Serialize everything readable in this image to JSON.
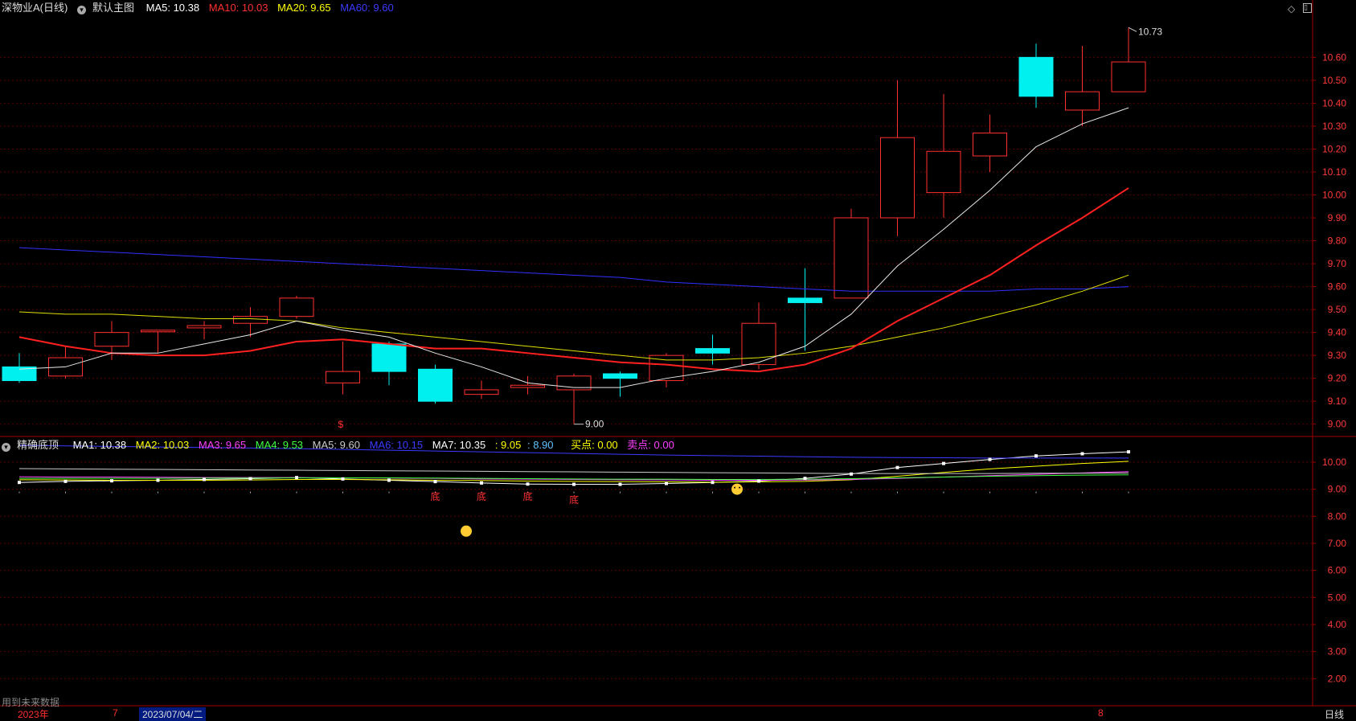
{
  "main_header": {
    "title": "深物业A(日线)",
    "dropdown_label": "默认主图",
    "ma": [
      {
        "label": "MA5: 10.38",
        "color": "#ffffff"
      },
      {
        "label": "MA10: 10.03",
        "color": "#ff3030"
      },
      {
        "label": "MA20: 9.65",
        "color": "#ffff00"
      },
      {
        "label": "MA60: 9.60",
        "color": "#3a3aff"
      }
    ]
  },
  "sub_header": {
    "title": "精确底顶",
    "items": [
      {
        "label": "MA1: 10.38",
        "color": "#ffffff"
      },
      {
        "label": "MA2: 10.03",
        "color": "#ffff00"
      },
      {
        "label": "MA3: 9.65",
        "color": "#ff40ff"
      },
      {
        "label": "MA4: 9.53",
        "color": "#40ff40"
      },
      {
        "label": "MA5: 9.60",
        "color": "#cccccc"
      },
      {
        "label": "MA6: 10.15",
        "color": "#3a3aff"
      },
      {
        "label": "MA7: 10.35",
        "color": "#ffffff"
      },
      {
        "label": ": 9.05",
        "color": "#ffff00"
      },
      {
        "label": ": 8.90",
        "color": "#60c0ff"
      },
      {
        "label": "买点: 0.00",
        "color": "#ffff00"
      },
      {
        "label": "卖点: 0.00",
        "color": "#ff40ff"
      }
    ]
  },
  "colors": {
    "up": "#ff3030",
    "down": "#00f0f0",
    "grid": "#5a0000"
  },
  "chart_data": [
    {
      "type": "candlestick",
      "ylim": [
        8.95,
        10.78
      ],
      "ticks": [
        "10.60",
        "10.50",
        "10.40",
        "10.30",
        "10.20",
        "10.10",
        "10.00",
        "9.90",
        "9.80",
        "9.70",
        "9.60",
        "9.50",
        "9.40",
        "9.30",
        "9.20",
        "9.10",
        "9.00"
      ],
      "candles": [
        {
          "o": 9.25,
          "h": 9.31,
          "l": 9.18,
          "c": 9.19
        },
        {
          "o": 9.21,
          "h": 9.34,
          "l": 9.2,
          "c": 9.29
        },
        {
          "o": 9.34,
          "h": 9.45,
          "l": 9.28,
          "c": 9.4
        },
        {
          "o": 9.41,
          "h": 9.41,
          "l": 9.31,
          "c": 9.41
        },
        {
          "o": 9.42,
          "h": 9.45,
          "l": 9.37,
          "c": 9.43
        },
        {
          "o": 9.44,
          "h": 9.51,
          "l": 9.38,
          "c": 9.47
        },
        {
          "o": 9.47,
          "h": 9.56,
          "l": 9.46,
          "c": 9.55
        },
        {
          "o": 9.18,
          "h": 9.36,
          "l": 9.13,
          "c": 9.23
        },
        {
          "o": 9.35,
          "h": 9.36,
          "l": 9.17,
          "c": 9.23
        },
        {
          "o": 9.24,
          "h": 9.26,
          "l": 9.09,
          "c": 9.1
        },
        {
          "o": 9.13,
          "h": 9.19,
          "l": 9.11,
          "c": 9.15
        },
        {
          "o": 9.16,
          "h": 9.21,
          "l": 9.13,
          "c": 9.17
        },
        {
          "o": 9.15,
          "h": 9.22,
          "l": 9.0,
          "c": 9.21
        },
        {
          "o": 9.22,
          "h": 9.23,
          "l": 9.12,
          "c": 9.2
        },
        {
          "o": 9.19,
          "h": 9.31,
          "l": 9.16,
          "c": 9.3
        },
        {
          "o": 9.33,
          "h": 9.39,
          "l": 9.26,
          "c": 9.31
        },
        {
          "o": 9.26,
          "h": 9.53,
          "l": 9.24,
          "c": 9.44
        },
        {
          "o": 9.55,
          "h": 9.68,
          "l": 9.32,
          "c": 9.53
        },
        {
          "o": 9.55,
          "h": 9.94,
          "l": 9.55,
          "c": 9.9
        },
        {
          "o": 9.9,
          "h": 10.5,
          "l": 9.82,
          "c": 10.25
        },
        {
          "o": 10.01,
          "h": 10.44,
          "l": 9.9,
          "c": 10.19
        },
        {
          "o": 10.17,
          "h": 10.35,
          "l": 10.1,
          "c": 10.27
        },
        {
          "o": 10.6,
          "h": 10.66,
          "l": 10.38,
          "c": 10.43
        },
        {
          "o": 10.37,
          "h": 10.65,
          "l": 10.3,
          "c": 10.45
        },
        {
          "o": 10.45,
          "h": 10.73,
          "l": 10.45,
          "c": 10.58
        }
      ],
      "ma5": [
        9.24,
        9.25,
        9.31,
        9.31,
        9.35,
        9.39,
        9.45,
        9.41,
        9.38,
        9.31,
        9.25,
        9.18,
        9.16,
        9.16,
        9.2,
        9.23,
        9.27,
        9.34,
        9.48,
        9.69,
        9.85,
        10.02,
        10.21,
        10.31,
        10.38
      ],
      "ma10": [
        9.38,
        9.34,
        9.31,
        9.3,
        9.3,
        9.32,
        9.36,
        9.37,
        9.35,
        9.33,
        9.33,
        9.31,
        9.29,
        9.27,
        9.26,
        9.24,
        9.23,
        9.26,
        9.33,
        9.45,
        9.55,
        9.65,
        9.78,
        9.9,
        10.03
      ],
      "ma20": [
        9.49,
        9.48,
        9.48,
        9.47,
        9.46,
        9.46,
        9.45,
        9.42,
        9.4,
        9.38,
        9.36,
        9.34,
        9.32,
        9.3,
        9.28,
        9.28,
        9.29,
        9.31,
        9.34,
        9.38,
        9.42,
        9.47,
        9.52,
        9.58,
        9.65
      ],
      "ma60": [
        9.77,
        9.76,
        9.75,
        9.74,
        9.73,
        9.72,
        9.71,
        9.7,
        9.69,
        9.68,
        9.67,
        9.66,
        9.65,
        9.64,
        9.62,
        9.61,
        9.6,
        9.59,
        9.58,
        9.58,
        9.58,
        9.58,
        9.59,
        9.59,
        9.6
      ],
      "annotations": {
        "high": "10.73",
        "low": "9.00",
        "marker": "$"
      }
    },
    {
      "type": "line",
      "ylim": [
        1.0,
        10.8
      ],
      "ticks": [
        "10.00",
        "9.00",
        "8.00",
        "7.00",
        "6.00",
        "5.00",
        "4.00",
        "3.00",
        "2.00"
      ],
      "series": [
        {
          "name": "MA1",
          "color": "#ffffff",
          "values": [
            9.25,
            9.29,
            9.31,
            9.33,
            9.36,
            9.39,
            9.43,
            9.38,
            9.33,
            9.28,
            9.23,
            9.19,
            9.18,
            9.18,
            9.21,
            9.25,
            9.3,
            9.4,
            9.56,
            9.8,
            9.95,
            10.1,
            10.23,
            10.31,
            10.38
          ]
        },
        {
          "name": "MA2",
          "color": "#ffff00",
          "values": [
            9.35,
            9.34,
            9.33,
            9.33,
            9.33,
            9.34,
            9.36,
            9.36,
            9.35,
            9.33,
            9.32,
            9.3,
            9.29,
            9.28,
            9.27,
            9.26,
            9.27,
            9.29,
            9.35,
            9.48,
            9.62,
            9.75,
            9.85,
            9.95,
            10.03
          ]
        },
        {
          "name": "MA3",
          "color": "#ff40ff",
          "values": [
            9.46,
            9.45,
            9.45,
            9.44,
            9.43,
            9.43,
            9.43,
            9.42,
            9.41,
            9.4,
            9.38,
            9.37,
            9.36,
            9.35,
            9.34,
            9.33,
            9.33,
            9.34,
            9.36,
            9.4,
            9.45,
            9.5,
            9.55,
            9.6,
            9.65
          ]
        },
        {
          "name": "MA4",
          "color": "#40ff40",
          "values": [
            9.4,
            9.4,
            9.4,
            9.4,
            9.41,
            9.41,
            9.42,
            9.42,
            9.42,
            9.41,
            9.4,
            9.39,
            9.38,
            9.37,
            9.37,
            9.36,
            9.36,
            9.37,
            9.39,
            9.42,
            9.45,
            9.48,
            9.5,
            9.52,
            9.53
          ]
        },
        {
          "name": "MA5",
          "color": "#cccccc",
          "values": [
            9.76,
            9.75,
            9.74,
            9.73,
            9.72,
            9.71,
            9.7,
            9.69,
            9.68,
            9.67,
            9.66,
            9.65,
            9.64,
            9.63,
            9.62,
            9.61,
            9.6,
            9.59,
            9.58,
            9.58,
            9.58,
            9.58,
            9.59,
            9.59,
            9.6
          ]
        },
        {
          "name": "MA6",
          "color": "#3a3aff",
          "values": [
            10.62,
            10.6,
            10.58,
            10.56,
            10.54,
            10.52,
            10.5,
            10.47,
            10.44,
            10.41,
            10.38,
            10.35,
            10.32,
            10.29,
            10.26,
            10.24,
            10.22,
            10.2,
            10.18,
            10.17,
            10.16,
            10.15,
            10.15,
            10.15,
            10.15
          ]
        }
      ],
      "dots": [
        9.25,
        9.29,
        9.31,
        9.33,
        9.36,
        9.39,
        9.43,
        9.38,
        9.33,
        9.28,
        9.23,
        9.19,
        9.18,
        9.18,
        9.21,
        9.25,
        9.3,
        9.4,
        9.56,
        9.8,
        9.95,
        10.1,
        10.23,
        10.31,
        10.38
      ],
      "bottom_labels": [
        "底",
        "底",
        "底",
        "底"
      ],
      "bottom_label_index": [
        9,
        10,
        11,
        12
      ]
    }
  ],
  "footer": {
    "note": "用到未来数据",
    "year": "2023年",
    "month1": "7",
    "date": "2023/07/04/二",
    "month2": "8",
    "period": "日线"
  }
}
